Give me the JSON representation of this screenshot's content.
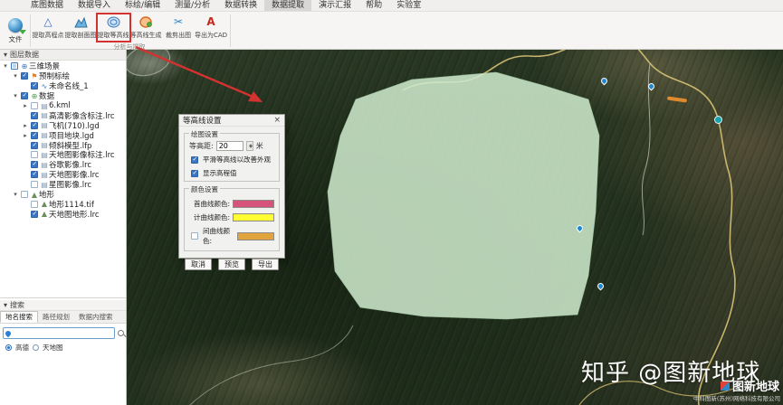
{
  "menu": {
    "items": [
      {
        "label": "底图数据"
      },
      {
        "label": "数据导入"
      },
      {
        "label": "标绘/编辑"
      },
      {
        "label": "测量/分析"
      },
      {
        "label": "数据转换"
      },
      {
        "label": "数据提取"
      },
      {
        "label": "演示汇报"
      },
      {
        "label": "帮助"
      },
      {
        "label": "实验室"
      }
    ],
    "active": "数据提取"
  },
  "ribbon": {
    "file_button": "文件",
    "group_label": "分析与提取",
    "tools": [
      {
        "label": "提取高程点",
        "icon": "elevation-point-icon",
        "glyph": "△"
      },
      {
        "label": "提取剖面图",
        "icon": "profile-chart-icon",
        "glyph": ""
      },
      {
        "label": "提取等高线",
        "icon": "contour-extract-icon",
        "glyph": "",
        "highlighted": true
      },
      {
        "label": "等高线生成",
        "icon": "contour-generate-icon",
        "glyph": ""
      },
      {
        "label": "裁剪出图",
        "icon": "scissors-icon",
        "glyph": "✂"
      },
      {
        "label": "导出为CAD",
        "icon": "cad-export-icon",
        "glyph": "A"
      }
    ]
  },
  "layers_panel": {
    "title": "图层数据",
    "collapse_glyph": "▾",
    "tree": [
      {
        "exp": "▾",
        "label": "三维场景",
        "icon_glyph": "⊕",
        "checked": "partial"
      },
      {
        "exp": "▾",
        "label": "预制标绘",
        "icon_glyph": "⚑",
        "checked": true
      },
      {
        "exp": "",
        "label": "未命名线_1",
        "icon_glyph": "∿",
        "checked": true
      },
      {
        "exp": "▾",
        "label": "数据",
        "icon_glyph": "⊕",
        "checked": true
      },
      {
        "exp": "▸",
        "label": "6.kml",
        "icon_glyph": "▤",
        "checked": false
      },
      {
        "exp": "",
        "label": "高清影像含标注.lrc",
        "icon_glyph": "▤",
        "checked": true
      },
      {
        "exp": "▸",
        "label": "飞机(710).lgd",
        "icon_glyph": "▤",
        "checked": true
      },
      {
        "exp": "▸",
        "label": "项目地块.lgd",
        "icon_glyph": "▤",
        "checked": true
      },
      {
        "exp": "",
        "label": "倾斜模型.lfp",
        "icon_glyph": "▤",
        "checked": true
      },
      {
        "exp": "",
        "label": "天地图影像标注.lrc",
        "icon_glyph": "▤",
        "checked": false
      },
      {
        "exp": "",
        "label": "谷歌影像.lrc",
        "icon_glyph": "▤",
        "checked": true
      },
      {
        "exp": "",
        "label": "天地图影像.lrc",
        "icon_glyph": "▤",
        "checked": true
      },
      {
        "exp": "",
        "label": "星图影像.lrc",
        "icon_glyph": "▤",
        "checked": false
      },
      {
        "exp": "▾",
        "label": "地形",
        "icon_glyph": "▲",
        "checked": false
      },
      {
        "exp": "",
        "label": "地形1114.tif",
        "icon_glyph": "▲",
        "checked": false
      },
      {
        "exp": "",
        "label": "天地图地形.lrc",
        "icon_glyph": "▲",
        "checked": true
      }
    ]
  },
  "search_panel": {
    "title": "搜索",
    "collapse_glyph": "▾",
    "tabs": [
      "地名搜索",
      "路径规划",
      "数据内搜索"
    ],
    "active_tab": "地名搜索",
    "input_value": "",
    "providers": [
      "高德",
      "天地图"
    ],
    "selected_provider": "高德"
  },
  "dialog": {
    "title": "等高线设置",
    "close_glyph": "×",
    "draw_section": {
      "title": "绘图设置",
      "interval_label": "等高距:",
      "interval_value": "20",
      "interval_unit": "米",
      "smooth_checkbox_label": "平滑等高线以改善外观",
      "smooth_checked": true,
      "show_label_checkbox_label": "显示高程值",
      "show_label_checked": true
    },
    "color_section": {
      "title": "颜色设置",
      "rows": [
        {
          "label": "首曲线颜色:",
          "color": "#d6537b"
        },
        {
          "label": "计曲线颜色:",
          "color": "#ffff33"
        },
        {
          "label": "间曲线颜色:",
          "color": "#e0a33e",
          "has_checkbox": true,
          "checked": false
        }
      ]
    },
    "buttons": [
      "取消",
      "预览",
      "导出"
    ]
  },
  "annotation": {
    "color": "#d23330"
  },
  "map": {
    "selection_polygon_color": "#cde9cd",
    "marker_icons": [
      "map-pin-icon",
      "map-pin-icon",
      "teal-dot-icon",
      "map-pin-icon",
      "map-pin-icon",
      "road-highlight"
    ]
  },
  "watermark": {
    "main": "知乎 @图新地球",
    "brand": "图新地球",
    "company": "中科图新(苏州)网络科技有限公司"
  }
}
